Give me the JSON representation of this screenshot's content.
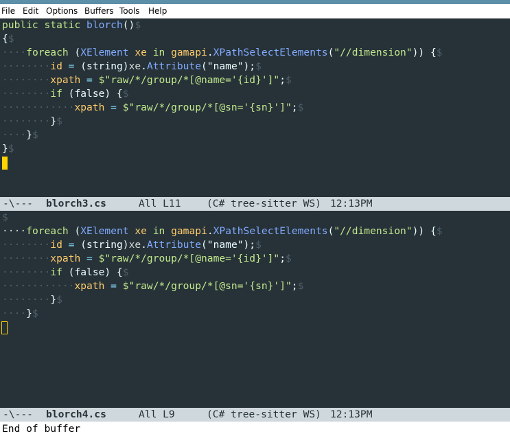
{
  "menu": [
    "File",
    "Edit",
    "Options",
    "Buffers",
    "Tools",
    "Help"
  ],
  "code": {
    "signature": [
      "public",
      "static",
      "blorch",
      "()"
    ],
    "open_brace": "{",
    "close_brace": "}",
    "foreach": "foreach",
    "open_paren": "(",
    "type": "XElement",
    "var": "xe",
    "in": "in",
    "obj": "gamapi",
    "dot": ".",
    "method": "XPathSelectElements",
    "query": "\"//dimension\"",
    "close_call": "))",
    "id_var": "id",
    "eq": "=",
    "cast": "(string)",
    "attr_method": "Attribute",
    "name_arg": "(\"name\");",
    "xpath_var": "xpath",
    "dollar": "$",
    "str_id": "\"raw/*/group/*[@name='{id}']\"",
    "str_sn": "\"raw/*/group/*[@sn='{sn}']\"",
    "semi": ";",
    "if": "if",
    "cond": "(false)",
    "eol": "$"
  },
  "windows": [
    {
      "modeline": {
        "status": "-\\---",
        "buffer": "blorch3.cs",
        "position": "All L11",
        "mode": "(C# tree-sitter WS)",
        "time": "12:13PM"
      }
    },
    {
      "modeline": {
        "status": "-\\---",
        "buffer": "blorch4.cs",
        "position": "All L9",
        "mode": "(C# tree-sitter WS)",
        "time": "12:13PM"
      }
    }
  ],
  "echo_area": "End of buffer",
  "colors": {
    "background": "#263238",
    "modeline": "#cfd8dc",
    "cursor": "#ffd400",
    "keyword": "#c3e88d",
    "function": "#82aaff",
    "property": "#ffcb6b",
    "whitespace": "#4e5f69"
  }
}
